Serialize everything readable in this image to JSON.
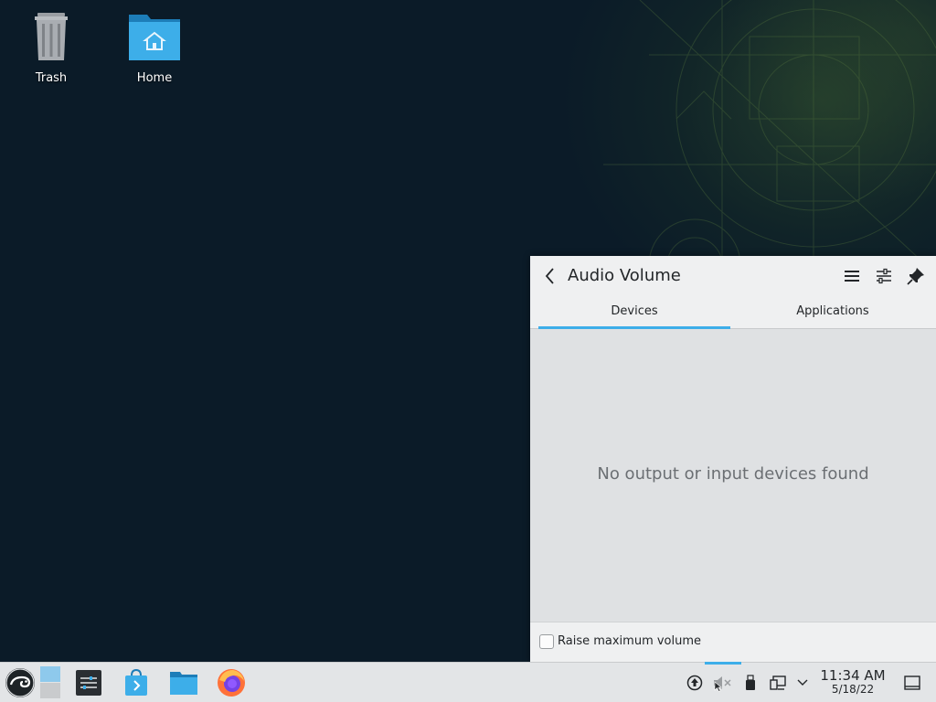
{
  "desktop": {
    "icons": [
      {
        "label": "Trash",
        "icon": "trash-icon"
      },
      {
        "label": "Home",
        "icon": "home-folder-icon"
      }
    ]
  },
  "popup": {
    "title": "Audio Volume",
    "tabs": [
      {
        "label": "Devices",
        "active": true
      },
      {
        "label": "Applications",
        "active": false
      }
    ],
    "empty_message": "No output or input devices found",
    "raise_max_volume_label": "Raise maximum volume",
    "raise_max_volume_checked": false,
    "accent_color": "#3daee9"
  },
  "taskbar": {
    "launchers": [
      "opensuse-menu-icon",
      "desktop-pager-icon",
      "settings-icon",
      "software-store-icon",
      "file-manager-icon",
      "firefox-icon"
    ],
    "tray": [
      "updates-icon",
      "audio-muted-icon",
      "usb-device-icon",
      "network-icon",
      "expand-tray-icon"
    ],
    "time": "11:34 AM",
    "date": "5/18/22",
    "show_desktop": "show-desktop-icon"
  }
}
